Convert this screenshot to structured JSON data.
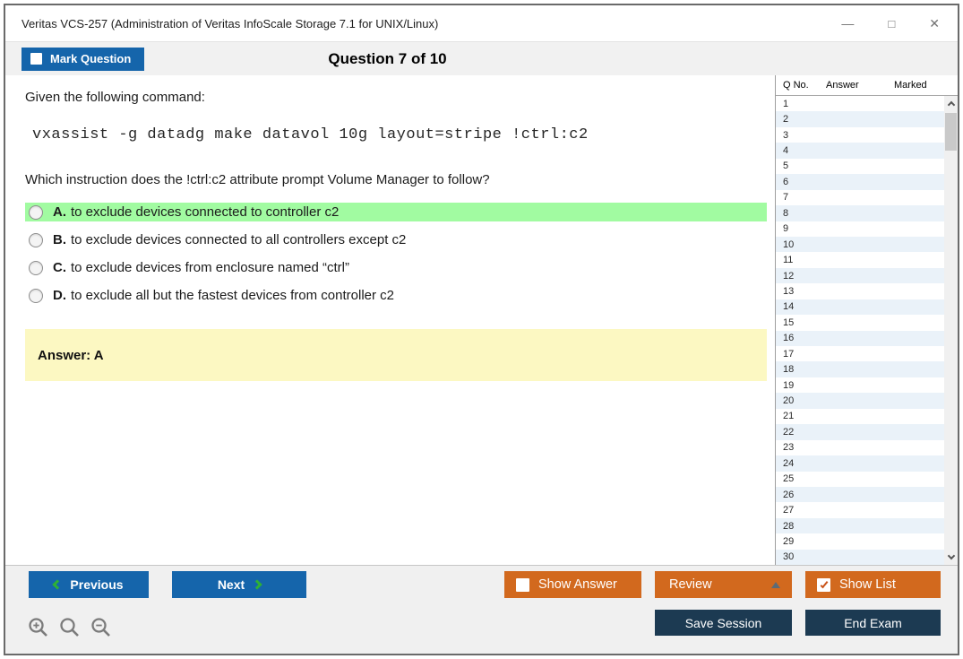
{
  "window": {
    "title": "Veritas VCS-257 (Administration of Veritas InfoScale Storage 7.1 for UNIX/Linux)"
  },
  "icons": {
    "minimize": "—",
    "maximize": "□",
    "close": "✕"
  },
  "header": {
    "mark_question_label": "Mark Question",
    "question_counter": "Question 7 of 10"
  },
  "question": {
    "intro": "Given the following command:",
    "command": "vxassist -g datadg make datavol 10g layout=stripe !ctrl:c2",
    "prompt": "Which instruction does the !ctrl:c2 attribute prompt Volume Manager to follow?",
    "options": [
      {
        "letter": "A.",
        "text": "to exclude devices connected to controller c2",
        "highlighted": true
      },
      {
        "letter": "B.",
        "text": "to exclude devices connected to all controllers except c2",
        "highlighted": false
      },
      {
        "letter": "C.",
        "text": "to exclude devices from enclosure named “ctrl”",
        "highlighted": false
      },
      {
        "letter": "D.",
        "text": "to exclude all but the fastest devices from controller c2",
        "highlighted": false
      }
    ],
    "answer_label": "Answer: A"
  },
  "question_list": {
    "headers": [
      "Q No.",
      "Answer",
      "Marked"
    ],
    "rows": [
      "1",
      "2",
      "3",
      "4",
      "5",
      "6",
      "7",
      "8",
      "9",
      "10",
      "11",
      "12",
      "13",
      "14",
      "15",
      "16",
      "17",
      "18",
      "19",
      "20",
      "21",
      "22",
      "23",
      "24",
      "25",
      "26",
      "27",
      "28",
      "29",
      "30"
    ]
  },
  "footer": {
    "previous_label": "Previous",
    "next_label": "Next",
    "show_answer_label": "Show Answer",
    "review_label": "Review",
    "show_list_label": "Show List",
    "save_session_label": "Save Session",
    "end_exam_label": "End Exam"
  },
  "colors": {
    "accent_blue": "#1565ab",
    "accent_orange": "#d2691e",
    "accent_navy": "#1c3a52",
    "highlight_green": "#a1fba1",
    "answer_yellow": "#fcf8c2",
    "chevron_green": "#2eb135",
    "alt_row_blue": "#eaf2f9"
  }
}
